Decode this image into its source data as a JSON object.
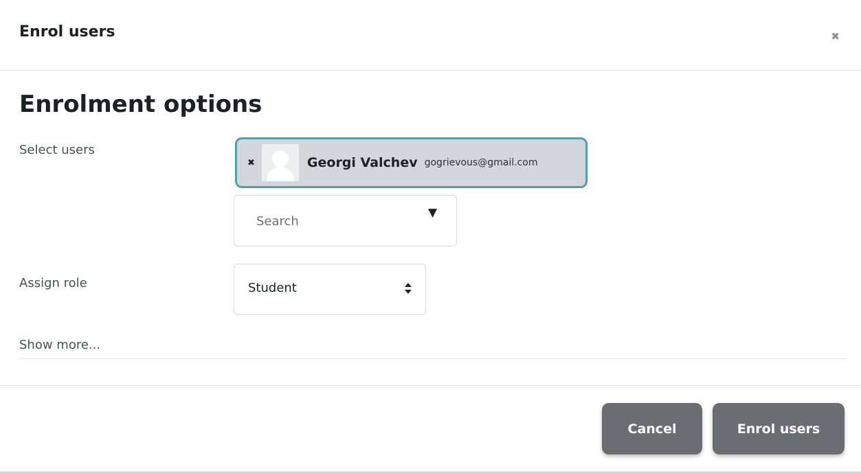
{
  "modal": {
    "title": "Enrol users",
    "close_icon": "close-icon",
    "close_glyph": "✖"
  },
  "section": {
    "title": "Enrolment options"
  },
  "select_users": {
    "label": "Select users",
    "selected": {
      "remove_glyph": "✖",
      "name": "Georgi Valchev",
      "email": "gogrievous@gmail.com"
    },
    "search": {
      "placeholder": "Search",
      "toggle_glyph": "▼"
    }
  },
  "assign_role": {
    "label": "Assign role",
    "selected_value": "Student"
  },
  "show_more": {
    "label": "Show more..."
  },
  "footer": {
    "cancel_label": "Cancel",
    "enrol_label": "Enrol users"
  },
  "colors": {
    "selected_border": "#4fa3a8",
    "selected_bg": "#d3d7db",
    "button_bg": "#6a6e72"
  }
}
